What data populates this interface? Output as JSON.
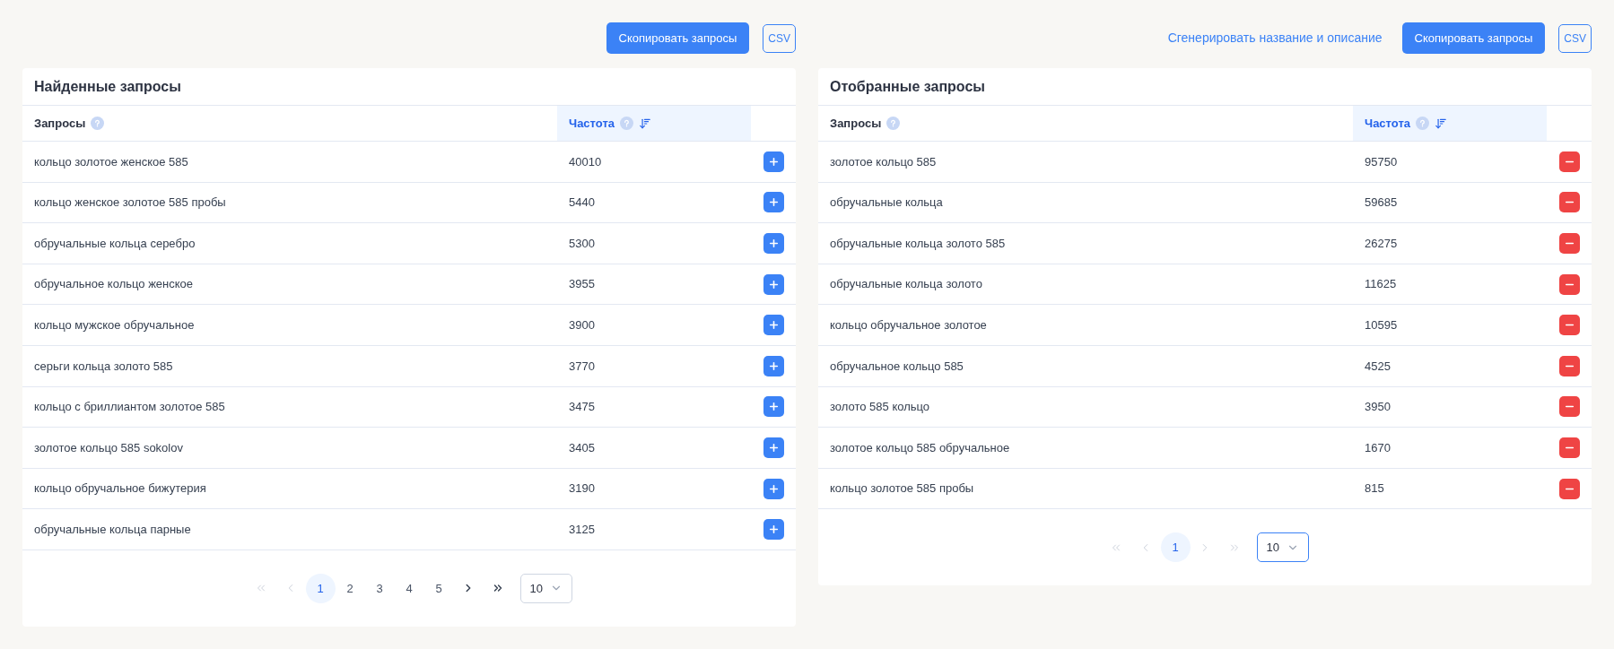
{
  "panels": [
    {
      "toolbar": {
        "copy_button": "Скопировать запросы",
        "csv_button": "CSV"
      },
      "title": "Найденные запросы",
      "columns": [
        {
          "label": "Запросы",
          "help": true,
          "sorted": false
        },
        {
          "label": "Частота",
          "help": true,
          "sorted": true
        }
      ],
      "rows": [
        {
          "kind": "add",
          "query": "кольцо золотое женское 585",
          "frequency": "40010"
        },
        {
          "kind": "add",
          "query": "кольцо женское золотое 585 пробы",
          "frequency": "5440"
        },
        {
          "kind": "add",
          "query": "обручальные кольца серебро",
          "frequency": "5300"
        },
        {
          "kind": "add",
          "query": "обручальное кольцо женское",
          "frequency": "3955"
        },
        {
          "kind": "add",
          "query": "кольцо мужское обручальное",
          "frequency": "3900"
        },
        {
          "kind": "add",
          "query": "серьги кольца золото 585",
          "frequency": "3770"
        },
        {
          "kind": "add",
          "query": "кольцо с бриллиантом золотое 585",
          "frequency": "3475"
        },
        {
          "kind": "add",
          "query": "золотое кольцо 585 sokolov",
          "frequency": "3405"
        },
        {
          "kind": "add",
          "query": "кольцо обручальное бижутерия",
          "frequency": "3190"
        },
        {
          "kind": "add",
          "query": "обручальные кольца парные",
          "frequency": "3125"
        }
      ],
      "pagination": {
        "first_disabled": true,
        "prev_disabled": true,
        "next_disabled": false,
        "last_disabled": false,
        "pages": [
          {
            "label": "1",
            "selected": true
          },
          {
            "label": "2",
            "selected": false
          },
          {
            "label": "3",
            "selected": false
          },
          {
            "label": "4",
            "selected": false
          },
          {
            "label": "5",
            "selected": false
          }
        ],
        "page_size": "10",
        "page_size_focused": false
      }
    },
    {
      "toolbar": {
        "link": "Сгенерировать название и описание",
        "copy_button": "Скопировать запросы",
        "csv_button": "CSV"
      },
      "title": "Отобранные запросы",
      "columns": [
        {
          "label": "Запросы",
          "help": true,
          "sorted": false
        },
        {
          "label": "Частота",
          "help": true,
          "sorted": true
        }
      ],
      "rows": [
        {
          "kind": "remove",
          "query": "золотое кольцо 585",
          "frequency": "95750"
        },
        {
          "kind": "remove",
          "query": "обручальные кольца",
          "frequency": "59685"
        },
        {
          "kind": "remove",
          "query": "обручальные кольца золото 585",
          "frequency": "26275"
        },
        {
          "kind": "remove",
          "query": "обручальные кольца золото",
          "frequency": "11625"
        },
        {
          "kind": "remove",
          "query": "кольцо обручальное золотое",
          "frequency": "10595"
        },
        {
          "kind": "remove",
          "query": "обручальное кольцо 585",
          "frequency": "4525"
        },
        {
          "kind": "remove",
          "query": "золото 585 кольцо",
          "frequency": "3950"
        },
        {
          "kind": "remove",
          "query": "золотое кольцо 585 обручальное",
          "frequency": "1670"
        },
        {
          "kind": "remove",
          "query": "кольцо золотое 585 пробы",
          "frequency": "815"
        }
      ],
      "pagination": {
        "first_disabled": true,
        "prev_disabled": true,
        "next_disabled": true,
        "last_disabled": true,
        "pages": [
          {
            "label": "1",
            "selected": true
          }
        ],
        "page_size": "10",
        "page_size_focused": true
      }
    }
  ]
}
